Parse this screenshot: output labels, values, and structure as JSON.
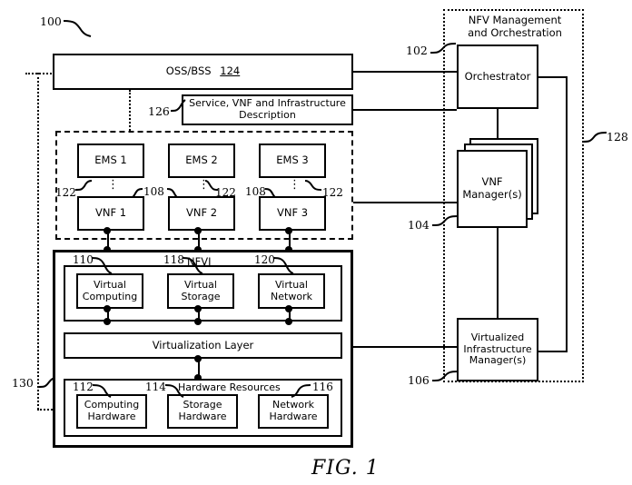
{
  "figure": {
    "caption": "FIG. 1",
    "system_ref": "100"
  },
  "left_column": {
    "oss_bss": {
      "label": "OSS/BSS",
      "ref": "124"
    },
    "description_box": {
      "label": "Service, VNF and Infrastructure Description",
      "ref": "126"
    },
    "ems_vnf_group": {
      "ems": [
        {
          "label": "EMS 1"
        },
        {
          "label": "EMS 2"
        },
        {
          "label": "EMS 3"
        }
      ],
      "vnf": [
        {
          "label": "VNF 1"
        },
        {
          "label": "VNF 2"
        },
        {
          "label": "VNF 3"
        }
      ],
      "refs": {
        "ems_vnf_link_1": "122",
        "ems_vnf_link_2": "108",
        "ems_vnf_link_3": "122",
        "ems_vnf_link_4": "108",
        "ems_vnf_link_5": "122"
      }
    },
    "nfvi": {
      "label": "NFVI",
      "ref": "130",
      "virtual_resources": [
        {
          "label": "Virtual Computing",
          "ref": "110"
        },
        {
          "label": "Virtual Storage",
          "ref": "118"
        },
        {
          "label": "Virtual Network",
          "ref": "120"
        }
      ],
      "virtualization_layer": {
        "label": "Virtualization Layer"
      },
      "hardware_resources": {
        "label": "Hardware Resources",
        "items": [
          {
            "label": "Computing Hardware",
            "ref": "112"
          },
          {
            "label": "Storage Hardware",
            "ref": "114"
          },
          {
            "label": "Network Hardware",
            "ref": "116"
          }
        ]
      }
    }
  },
  "right_column": {
    "mano": {
      "title_line1": "NFV Management",
      "title_line2": "and Orchestration",
      "ref": "128"
    },
    "orchestrator": {
      "label": "Orchestrator",
      "ref": "102"
    },
    "vnf_manager": {
      "label_line1": "VNF",
      "label_line2": "Manager(s)",
      "ref": "104"
    },
    "vim": {
      "label_line1": "Virtualized",
      "label_line2": "Infrastructure",
      "label_line3": "Manager(s)",
      "ref": "106"
    }
  }
}
